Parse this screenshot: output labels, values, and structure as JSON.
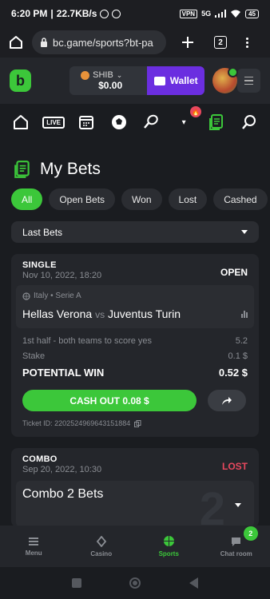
{
  "status_bar": {
    "time": "6:20 PM",
    "speed": "22.7KB/s",
    "vpn": "VPN",
    "network": "5G",
    "battery": "45"
  },
  "browser": {
    "url": "bc.game/sports?bt-pa",
    "tab_count": "2"
  },
  "header": {
    "currency": "SHIB",
    "balance": "$0.00",
    "wallet_label": "Wallet"
  },
  "sport_nav": {
    "live_label": "LIVE"
  },
  "page": {
    "title": "My Bets",
    "filters": [
      "All",
      "Open Bets",
      "Won",
      "Lost",
      "Cashed"
    ],
    "active_filter": "All",
    "period_select": "Last Bets"
  },
  "bets": [
    {
      "type": "SINGLE",
      "date": "Nov 10, 2022, 18:20",
      "status": "OPEN",
      "league": "Italy • Serie A",
      "home": "Hellas Verona",
      "vs": "vs",
      "away": "Juventus Turin",
      "market": "1st half - both teams to score yes",
      "odds": "5.2",
      "stake_label": "Stake",
      "stake": "0.1 $",
      "win_label": "POTENTIAL WIN",
      "win_value": "0.52 $",
      "cashout_label": "CASH OUT 0.08 $",
      "ticket": "Ticket ID: 2202524969643151884"
    },
    {
      "type": "COMBO",
      "date": "Sep 20, 2022, 10:30",
      "status": "LOST",
      "combo_label": "Combo 2 Bets",
      "combo_count": "2"
    }
  ],
  "tabbar": {
    "menu": "Menu",
    "casino": "Casino",
    "sports": "Sports",
    "chat": "Chat room",
    "chat_badge": "2"
  },
  "colors": {
    "accent": "#3cc73a",
    "wallet": "#6b2ee0",
    "lost": "#e8485e"
  }
}
